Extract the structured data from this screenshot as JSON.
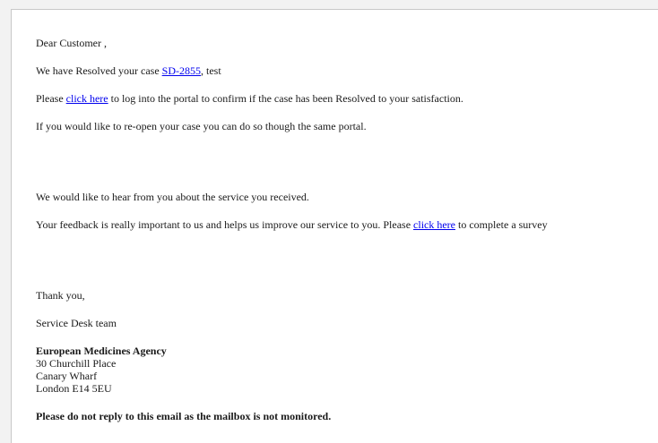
{
  "email": {
    "greeting": "Dear Customer ,",
    "resolved": {
      "prefix": "We have Resolved your case ",
      "case_link": "SD-2855",
      "suffix": ", test"
    },
    "confirm": {
      "prefix": "Please ",
      "link": "click here",
      "suffix": " to log into the portal to confirm if the case has been Resolved to your satisfaction."
    },
    "reopen": "If you would like to re-open your case you can do so though the same portal.",
    "feedback_intro": "We would like to hear from you about the service you received.",
    "feedback": {
      "prefix": "Your feedback is really important to us and helps us improve our service to you. Please ",
      "link": "click here",
      "suffix": " to complete a survey"
    },
    "thanks": "Thank you,",
    "team": "Service Desk team",
    "signature": {
      "org": "European Medicines Agency",
      "address1": "30 Churchill Place",
      "address2": "Canary Wharf",
      "address3": "London E14 5EU"
    },
    "notice": "Please do not reply to this email as the mailbox is not monitored."
  },
  "colors": {
    "link": "#0000ee",
    "text": "#1a1a1a",
    "background": "#ffffff"
  }
}
